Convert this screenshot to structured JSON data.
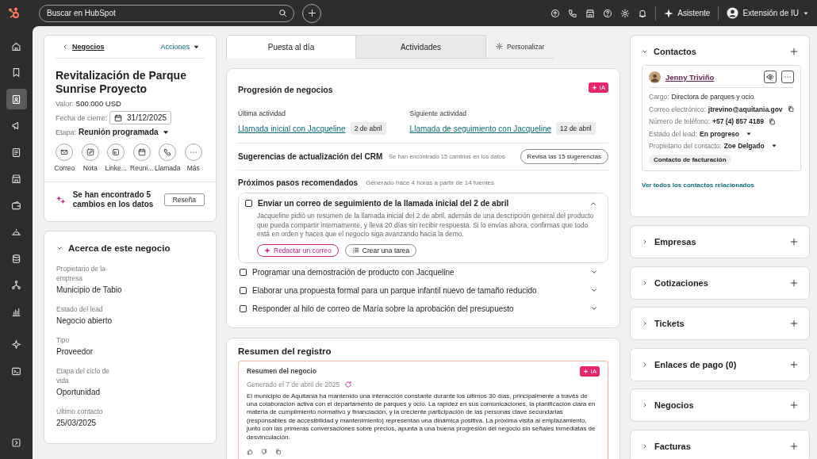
{
  "topbar": {
    "search": {
      "placeholder": "Buscar en HubSpot"
    },
    "assistant": "Asistente",
    "account": "Extensión de IU"
  },
  "sidebar": {
    "items": [
      {
        "selected": false
      },
      {
        "selected": false
      },
      {
        "selected": true
      },
      {
        "selected": false
      },
      {
        "selected": false
      },
      {
        "selected": false
      },
      {
        "selected": false
      },
      {
        "selected": false
      },
      {
        "selected": false
      },
      {
        "selected": false
      },
      {
        "selected": false
      },
      {
        "selected": false
      },
      {
        "selected": false
      }
    ]
  },
  "deal": {
    "back": "Negocios",
    "actions_menu": "Acciones",
    "title": "Revitalización de Parque Sunrise Proyecto",
    "value": {
      "label": "Valor:",
      "value": "500.000 USD"
    },
    "close_date": {
      "label": "Fecha de cierre:",
      "value": "31/12/2025"
    },
    "stage": {
      "label": "Etapa:",
      "value": "Reunión programada"
    },
    "actions": [
      {
        "kind": "email",
        "label": "Correo"
      },
      {
        "kind": "note",
        "label": "Nota"
      },
      {
        "kind": "linkedin",
        "label": "Linke..."
      },
      {
        "kind": "meeting",
        "label": "Reuni..."
      },
      {
        "kind": "call",
        "label": "Llamada"
      },
      {
        "kind": "more",
        "label": "Más"
      }
    ],
    "insight": {
      "text": "Se han encontrado 5 cambios en los datos",
      "button": "Reseña"
    }
  },
  "about": {
    "title": "Acerca de este negocio",
    "expanded": true,
    "properties": [
      {
        "label": "Propietario de la empresa",
        "value": "Municipio de Tabio"
      },
      {
        "label": "Estado del lead",
        "value": "Negocio abierto"
      },
      {
        "label": "Tipo",
        "value": "Proveedor"
      },
      {
        "label": "Etapa del ciclo de vida",
        "value": "Oportunidad"
      },
      {
        "label": "Último contacto",
        "value": "25/03/2025"
      }
    ]
  },
  "tabs": [
    {
      "label": "Puesta al día",
      "selected": true
    },
    {
      "label": "Actividades",
      "selected": false
    }
  ],
  "customize": "Personalizar",
  "progression": {
    "title": "Progresión de negocios",
    "badge": "IA",
    "last_activity": {
      "label": "Última actividad",
      "link": "Llamada inicial con Jacqueline",
      "date": "2 de abril"
    },
    "next_activity": {
      "label": "Siguiente actividad",
      "link": "Llamada de seguimiento con Jacqueline",
      "date": "12 de abril"
    },
    "crm": {
      "title": "Sugerencias de actualización del CRM",
      "note": "Se han encontrado 15 cambios en los datos",
      "button": "Revisa las 15 sugerencias"
    },
    "next_steps": {
      "title": "Próximos pasos recomendados",
      "note": "Generado hace 4 horas a partir de 14 fuentes",
      "items": [
        {
          "text": "Enviar un correo de seguimiento de la llamada inicial del 2 de abril",
          "checked": false,
          "expanded": true,
          "description": "Jacqueline pidió un resumen de la llamada inicial del 2 de abril, además de una descripción general del producto que pueda compartir internamente, y lleva 20 días sin recibir respuesta. Si lo envías ahora, confirmas que todo está en orden y haces que el negocio siga avanzando hacia la demo.",
          "actions": [
            {
              "kind": "ai",
              "label": "Redactar un correo"
            },
            {
              "kind": "task",
              "label": "Crear una tarea"
            }
          ]
        },
        {
          "text": "Programar una demostración de producto con Jacqueline",
          "checked": false,
          "expanded": false
        },
        {
          "text": "Elaborar una propuesta formal para un parque infantil nuevo de tamaño reducido",
          "checked": false,
          "expanded": false
        },
        {
          "text": "Responder al hilo de correo de María sobre la aprobación del presupuesto",
          "checked": false,
          "expanded": false
        }
      ]
    }
  },
  "record_summary": {
    "title": "Resumen del registro",
    "card_title": "Resumen del negocio",
    "badge": "IA",
    "generated": "Generado el 7 de abril de 2025",
    "body": "El municipio de Aquitania ha mantenido una interacción constante durante los últimos 30 días, principalmente a través de una colaboración activa con el departamento de parques y ocio. La rapidez en sus comunicaciones, la planificación clara en materia de cumplimiento normativo y financiación, y la creciente participación de las personas clave secundarias (responsables de accesibilidad y mantenimiento) representan una dinámica positiva. La próxima visita al emplazamiento, junto con las primeras conversaciones sobre precios, apunta a una buena progresión del negocio sin señales inmediatas de desvinculación."
  },
  "contacts": {
    "title": "Contactos",
    "expanded": true,
    "contact": {
      "name": "Jenny Triviño",
      "fields": [
        {
          "kind": "plain",
          "label": "Cargo:",
          "value": "Directora de parques y ocio"
        },
        {
          "kind": "copy",
          "label": "Correo electrónico:",
          "value": "jtrevino@aquitania.gov"
        },
        {
          "kind": "copy",
          "label": "Número de teléfono:",
          "value": "+57 (4) 857 4189"
        },
        {
          "kind": "dropdown",
          "label": "Estado del lead:",
          "value": "En progreso"
        },
        {
          "kind": "dropdown",
          "label": "Propietario del contacto:",
          "value": "Zoe Delgado"
        }
      ],
      "tag": "Contacto de facturación"
    },
    "link": "Ver todos los contactos relacionados"
  },
  "sections": [
    {
      "title": "Empresas",
      "expanded": false
    },
    {
      "title": "Cotizaciones",
      "expanded": false
    },
    {
      "title": "Tickets",
      "expanded": false
    },
    {
      "title": "Enlaces de pago (0)",
      "expanded": false
    },
    {
      "title": "Negocios",
      "expanded": false
    },
    {
      "title": "Facturas",
      "expanded": false
    }
  ]
}
